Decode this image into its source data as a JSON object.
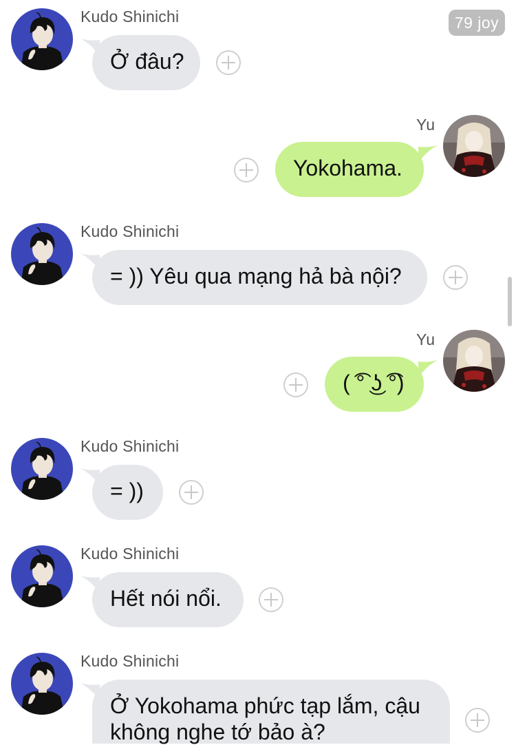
{
  "badge": {
    "label": "79 joy"
  },
  "participants": {
    "other": "Kudo Shinichi",
    "me": "Yu"
  },
  "messages": [
    {
      "sender": "Kudo Shinichi",
      "text": "Ở đâu?"
    },
    {
      "sender": "Yu",
      "text": "Yokohama."
    },
    {
      "sender": "Kudo Shinichi",
      "text": "= )) Yêu qua mạng hả bà nội?"
    },
    {
      "sender": "Yu",
      "text": "( ͡° ͜ʖ ͡°)"
    },
    {
      "sender": "Kudo Shinichi",
      "text": "= ))"
    },
    {
      "sender": "Kudo Shinichi",
      "text": "Hết nói nổi."
    },
    {
      "sender": "Kudo Shinichi",
      "text_line1": "Ở Yokohama phức tạp lắm, cậu",
      "text_line2": "không nghe tớ bảo à?"
    }
  ],
  "colors": {
    "incoming_bubble": "#e5e7ea",
    "outgoing_bubble": "#c9f190",
    "kudo_avatar_bg": "#3b47b8",
    "badge_bg": "#bdbdbd"
  },
  "icons": {
    "reaction": "add-reaction-icon",
    "tail_in": "bubble-tail-left",
    "tail_out": "bubble-tail-right"
  }
}
